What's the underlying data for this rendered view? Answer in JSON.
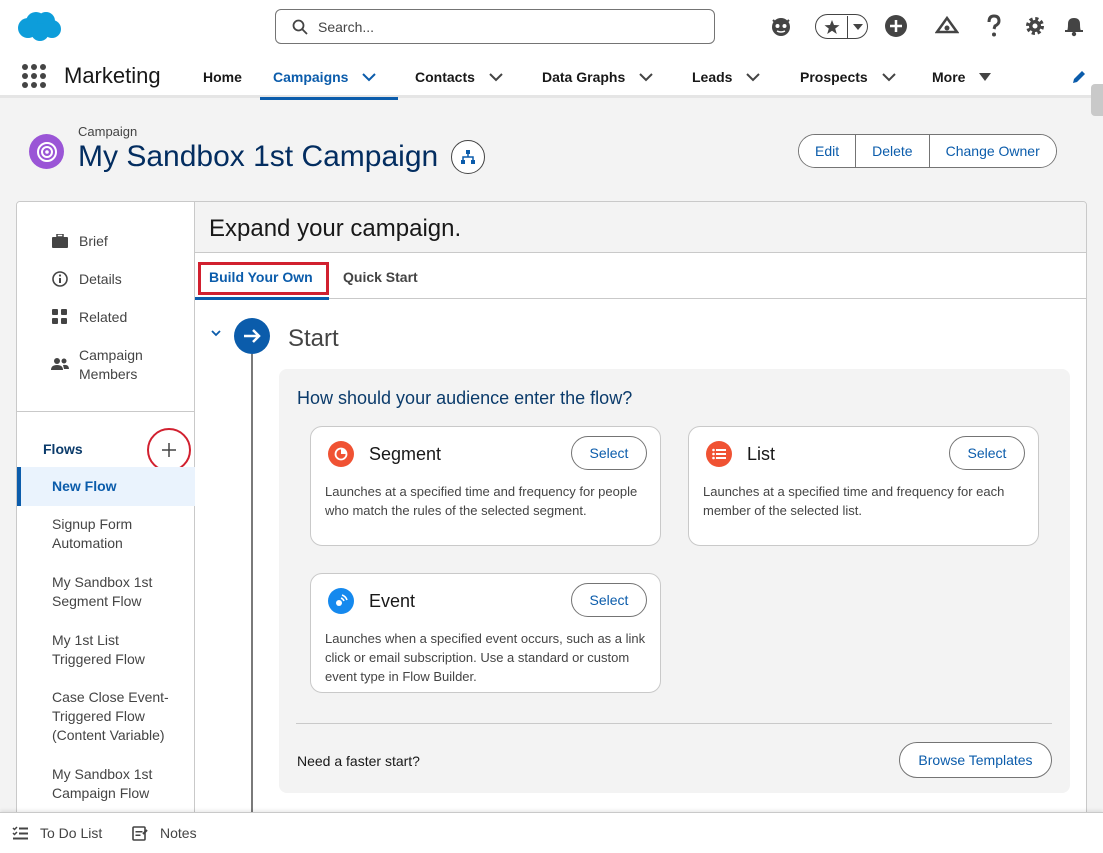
{
  "header": {
    "search_placeholder": "Search..."
  },
  "nav": {
    "app_name": "Marketing",
    "items": [
      {
        "label": "Home"
      },
      {
        "label": "Campaigns"
      },
      {
        "label": "Contacts"
      },
      {
        "label": "Data Graphs"
      },
      {
        "label": "Leads"
      },
      {
        "label": "Prospects"
      },
      {
        "label": "More"
      }
    ]
  },
  "record": {
    "type": "Campaign",
    "title": "My Sandbox 1st Campaign",
    "actions": [
      "Edit",
      "Delete",
      "Change Owner"
    ]
  },
  "sidebar": {
    "links": [
      {
        "label": "Brief",
        "icon": "briefcase-icon"
      },
      {
        "label": "Details",
        "icon": "info-icon"
      },
      {
        "label": "Related",
        "icon": "apps-icon"
      },
      {
        "label": "Campaign Members",
        "icon": "people-icon"
      }
    ],
    "flows_header": "Flows",
    "flows": [
      "New Flow",
      "Signup Form Automation",
      "My Sandbox 1st Segment Flow",
      "My 1st List Triggered Flow",
      "Case Close Event-Triggered Flow (Content Variable)",
      "My Sandbox 1st Campaign Flow"
    ]
  },
  "main": {
    "title": "Expand your campaign.",
    "tabs": [
      "Build Your Own",
      "Quick Start"
    ],
    "start_label": "Start",
    "question": "How should your audience enter the flow?",
    "options": [
      {
        "title": "Segment",
        "select": "Select",
        "desc": "Launches at a specified time and frequency for people who match the rules of the selected segment.",
        "color": "#f05233"
      },
      {
        "title": "List",
        "select": "Select",
        "desc": "Launches at a specified time and frequency for each member of the selected list.",
        "color": "#f05233"
      },
      {
        "title": "Event",
        "select": "Select",
        "desc": "Launches when a specified event occurs, such as a link click or email subscription. Use a standard or custom event type in Flow Builder.",
        "color": "#1589ee"
      }
    ],
    "faster_text": "Need a faster start?",
    "browse_label": "Browse Templates"
  },
  "utility": {
    "items": [
      "To Do List",
      "Notes"
    ]
  },
  "colors": {
    "brand_blue": "#0b5cab",
    "campaign_purple": "#9a55d6",
    "highlight_red": "#d1202f"
  }
}
